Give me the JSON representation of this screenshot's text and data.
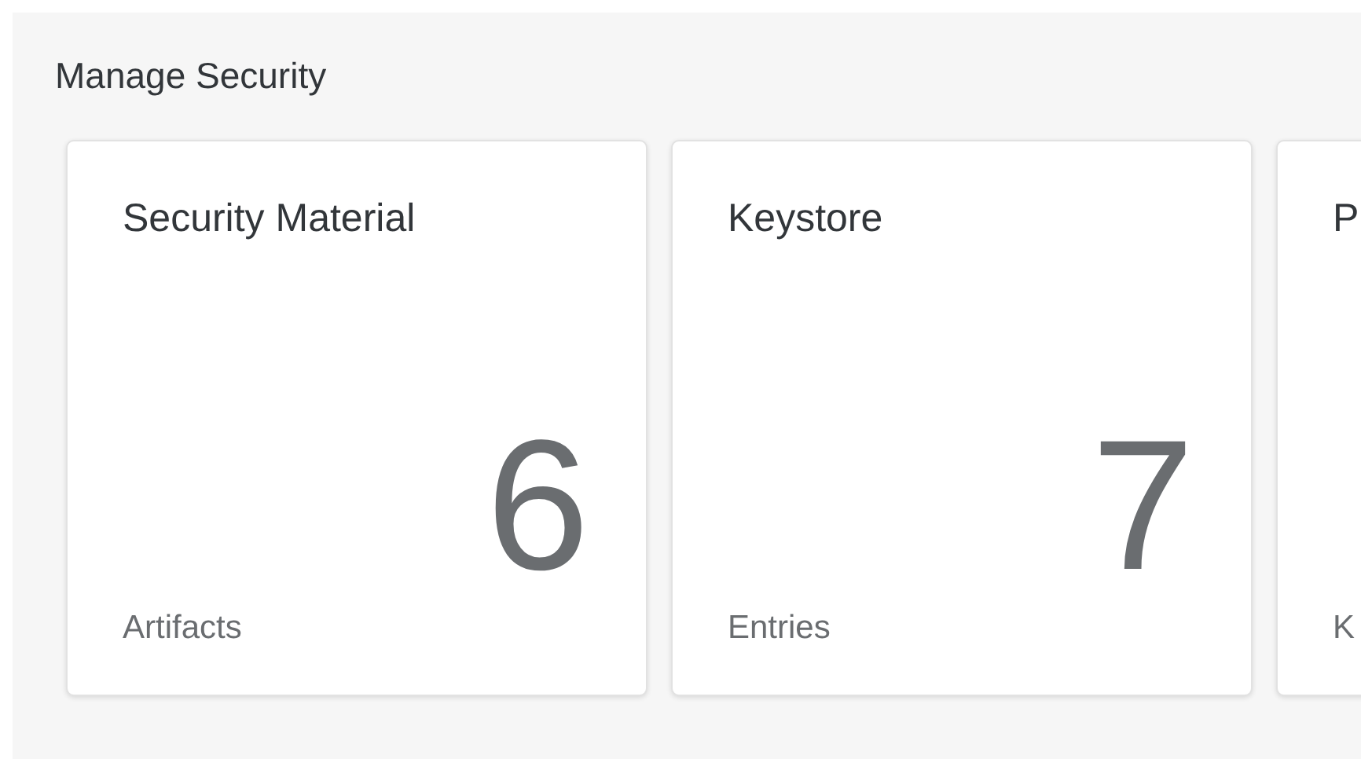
{
  "title": "Manage Security",
  "tiles": [
    {
      "title": "Security Material",
      "value": "6",
      "unit": "Artifacts"
    },
    {
      "title": "Keystore",
      "value": "7",
      "unit": "Entries"
    },
    {
      "title": "P",
      "unit": "K"
    }
  ]
}
